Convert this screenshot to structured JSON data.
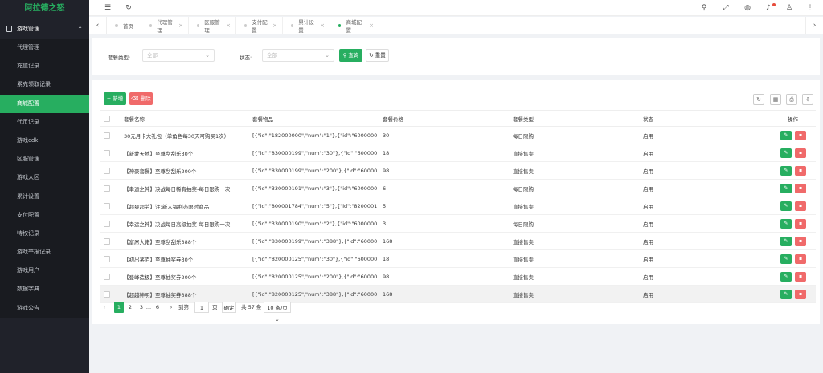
{
  "app": {
    "title": "阿拉德之怒"
  },
  "sidebar": {
    "group": "游戏管理",
    "items": [
      "代理管理",
      "充值记录",
      "累充领取记录",
      "商城配置",
      "代币记录",
      "游戏cdk",
      "区服管理",
      "游戏大区",
      "累计设置",
      "支付配置",
      "特权记录",
      "游戏举报记录",
      "游戏用户",
      "数据字典",
      "游戏公告"
    ],
    "active_index": 3
  },
  "tabs": [
    "首页",
    "代理管理",
    "区服管理",
    "支付配置",
    "累计设置",
    "商城配置"
  ],
  "active_tab": 5,
  "filter": {
    "type_label": "套餐类型:",
    "type_placeholder": "全部",
    "status_label": "状态:",
    "status_placeholder": "全部",
    "search_label": "查询",
    "reset_label": "重置"
  },
  "toolbar": {
    "add_label": "新增",
    "delete_label": "删除"
  },
  "table": {
    "columns": [
      "套餐名称",
      "套餐物品",
      "套餐价格",
      "套餐类型",
      "状态",
      "操作"
    ],
    "rows": [
      {
        "name": "30元月卡大礼包（单角色每30天可购买1次）",
        "items": "[{\"id\":\"182000000\",\"num\":\"1\"},{\"id\":\"600000063...",
        "price": "30",
        "type": "每日限购",
        "status": "启用"
      },
      {
        "name": "【新蒙天地】至尊刮刮乐30个",
        "items": "[{\"id\":\"830000199\",\"num\":\"30\"},{\"id\":\"600000006...",
        "price": "18",
        "type": "直接售卖",
        "status": "启用"
      },
      {
        "name": "【神豪套餐】至尊刮刮乐200个",
        "items": "[{\"id\":\"830000199\",\"num\":\"200\"},{\"id\":\"600000...",
        "price": "98",
        "type": "直接售卖",
        "status": "启用"
      },
      {
        "name": "【幸运之神】决战每日稀有抽奖-每日限购一次",
        "items": "[{\"id\":\"330000191\",\"num\":\"3\"},{\"id\":\"600000063...",
        "price": "6",
        "type": "每日限购",
        "status": "启用"
      },
      {
        "name": "【超爽超劳】注:新人福利亦限时商品",
        "items": "[{\"id\":\"800001784\",\"num\":\"5\"},{\"id\":\"820000120...",
        "price": "5",
        "type": "直接售卖",
        "status": "启用"
      },
      {
        "name": "【幸运之神】决战每日高级抽奖-每日限购一次",
        "items": "[{\"id\":\"330000190\",\"num\":\"2\"},{\"id\":\"600000063...",
        "price": "3",
        "type": "每日限购",
        "status": "启用"
      },
      {
        "name": "【富屌大佬】至尊刮刮乐388个",
        "items": "[{\"id\":\"830000199\",\"num\":\"388\"},{\"id\":\"600000...",
        "price": "168",
        "type": "直接售卖",
        "status": "启用"
      },
      {
        "name": "【初出茅庐】至尊抽奖券30个",
        "items": "[{\"id\":\"820000125\",\"num\":\"30\"},{\"id\":\"600000006...",
        "price": "18",
        "type": "直接售卖",
        "status": "启用"
      },
      {
        "name": "【登峰造极】至尊抽奖券200个",
        "items": "[{\"id\":\"820000125\",\"num\":\"200\"},{\"id\":\"600000...",
        "price": "98",
        "type": "直接售卖",
        "status": "启用"
      },
      {
        "name": "【超越神明】至尊抽奖券388个",
        "items": "[{\"id\":\"820000125\",\"num\":\"388\"},{\"id\":\"600000...",
        "price": "168",
        "type": "直接售卖",
        "status": "启用"
      }
    ]
  },
  "pager": {
    "pages": [
      "1",
      "2",
      "3",
      "...",
      "6"
    ],
    "goto_label": "到第",
    "goto_value": "1",
    "page_unit": "页",
    "confirm_label": "确定",
    "total_label": "共 57 条",
    "size_label": "10 条/页"
  }
}
